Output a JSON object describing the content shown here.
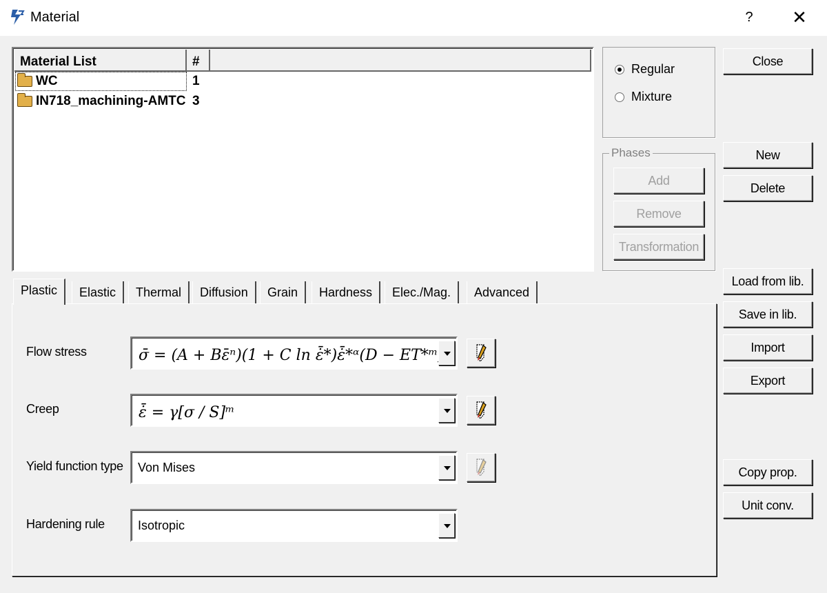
{
  "window": {
    "title": "Material",
    "help_label": "?",
    "close_glyph": "✕"
  },
  "material_list": {
    "headers": [
      "Material List",
      "#",
      ""
    ],
    "rows": [
      {
        "name": "WC",
        "num": "1"
      },
      {
        "name": "IN718_machining-AMTC",
        "num": "3"
      }
    ]
  },
  "material_type": {
    "options": [
      "Regular",
      "Mixture"
    ],
    "selected": "Regular"
  },
  "phases": {
    "label": "Phases",
    "buttons": [
      "Add",
      "Remove",
      "Transformation"
    ]
  },
  "right_buttons": {
    "close": "Close",
    "new": "New",
    "delete": "Delete",
    "load": "Load from lib.",
    "save": "Save in lib.",
    "import": "Import",
    "export": "Export",
    "copy": "Copy prop.",
    "unit": "Unit conv."
  },
  "tabs": [
    "Plastic",
    "Elastic",
    "Thermal",
    "Diffusion",
    "Grain",
    "Hardness",
    "Elec./Mag.",
    "Advanced"
  ],
  "active_tab": "Plastic",
  "plastic": {
    "flow_stress_label": "Flow stress",
    "creep_label": "Creep",
    "yield_label": "Yield function type",
    "yield_value": "Von Mises",
    "hardening_label": "Hardening rule",
    "hardening_value": "Isotropic"
  },
  "icons": {
    "app": "deform-logo-icon",
    "edit": "pencil-edit-icon",
    "folder": "folder-icon"
  }
}
